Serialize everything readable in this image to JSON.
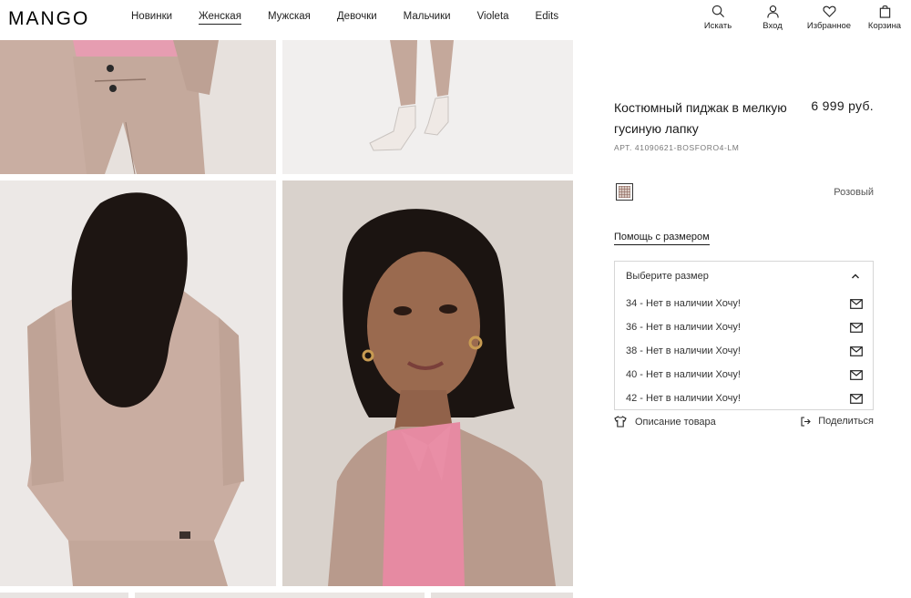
{
  "header": {
    "logo": "MANGO",
    "nav": [
      "Новинки",
      "Женская",
      "Мужская",
      "Девочки",
      "Мальчики",
      "Violeta",
      "Edits"
    ],
    "active_nav": "Женская",
    "actions": {
      "search": "Искать",
      "login": "Вход",
      "favorites": "Избранное",
      "cart": "Корзина"
    }
  },
  "product": {
    "title": "Костюмный пиджак в мелкую гусиную лапку",
    "price": "6 999 руб.",
    "article": "АРТ. 41090621-BOSFORO4-LM",
    "color_name": "Розовый",
    "size_help": "Помощь с размером",
    "size_select": {
      "placeholder": "Выберите размер",
      "options": [
        "34 - Нет в наличии Хочу!",
        "36 - Нет в наличии Хочу!",
        "38 - Нет в наличии Хочу!",
        "40 - Нет в наличии Хочу!",
        "42 - Нет в наличии Хочу!"
      ]
    },
    "description_link": "Описание товара",
    "share_link": "Поделиться"
  },
  "icons": {
    "search": "search-icon",
    "user": "user-icon",
    "heart": "heart-icon",
    "bag": "bag-icon",
    "mail": "mail-icon",
    "shirt": "shirt-icon",
    "share": "share-icon",
    "chevron": "chevron-up-icon"
  }
}
